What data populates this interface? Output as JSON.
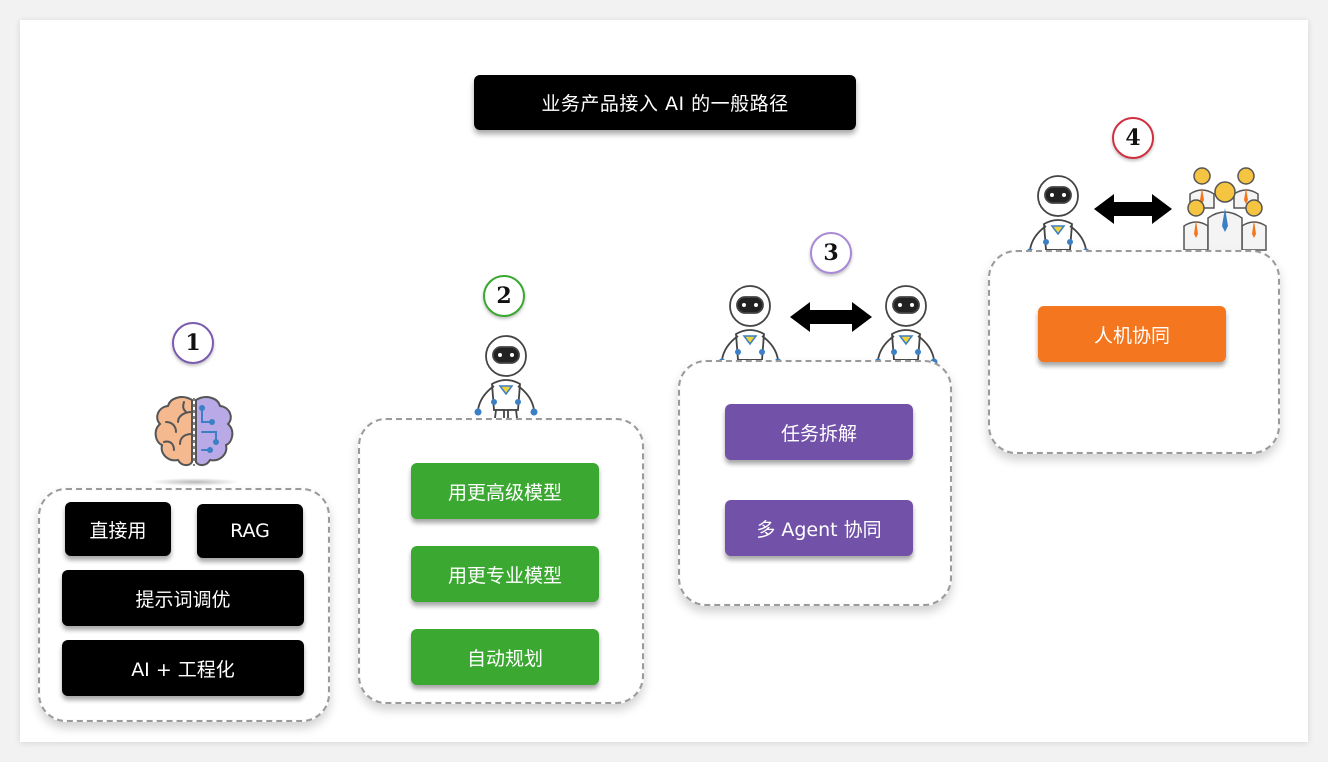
{
  "title": "业务产品接入 AI 的一般路径",
  "stages": [
    {
      "number": "1",
      "ring_color": "#7a5bb0",
      "buttons": [
        "直接用",
        "RAG",
        "提示词调优",
        "AI + 工程化"
      ]
    },
    {
      "number": "2",
      "ring_color": "#3aa831",
      "buttons": [
        "用更高级模型",
        "用更专业模型",
        "自动规划"
      ]
    },
    {
      "number": "3",
      "ring_color": "#a98ad6",
      "buttons": [
        "任务拆解",
        "多 Agent 协同"
      ]
    },
    {
      "number": "4",
      "ring_color": "#d02f3f",
      "buttons": [
        "人机协同"
      ]
    }
  ],
  "colors": {
    "black": "#000000",
    "green": "#3aa831",
    "purple": "#7252a8",
    "orange": "#f4761f"
  },
  "icons": [
    "brain-icon",
    "robot-icon",
    "double-arrow-icon",
    "people-group-icon"
  ]
}
